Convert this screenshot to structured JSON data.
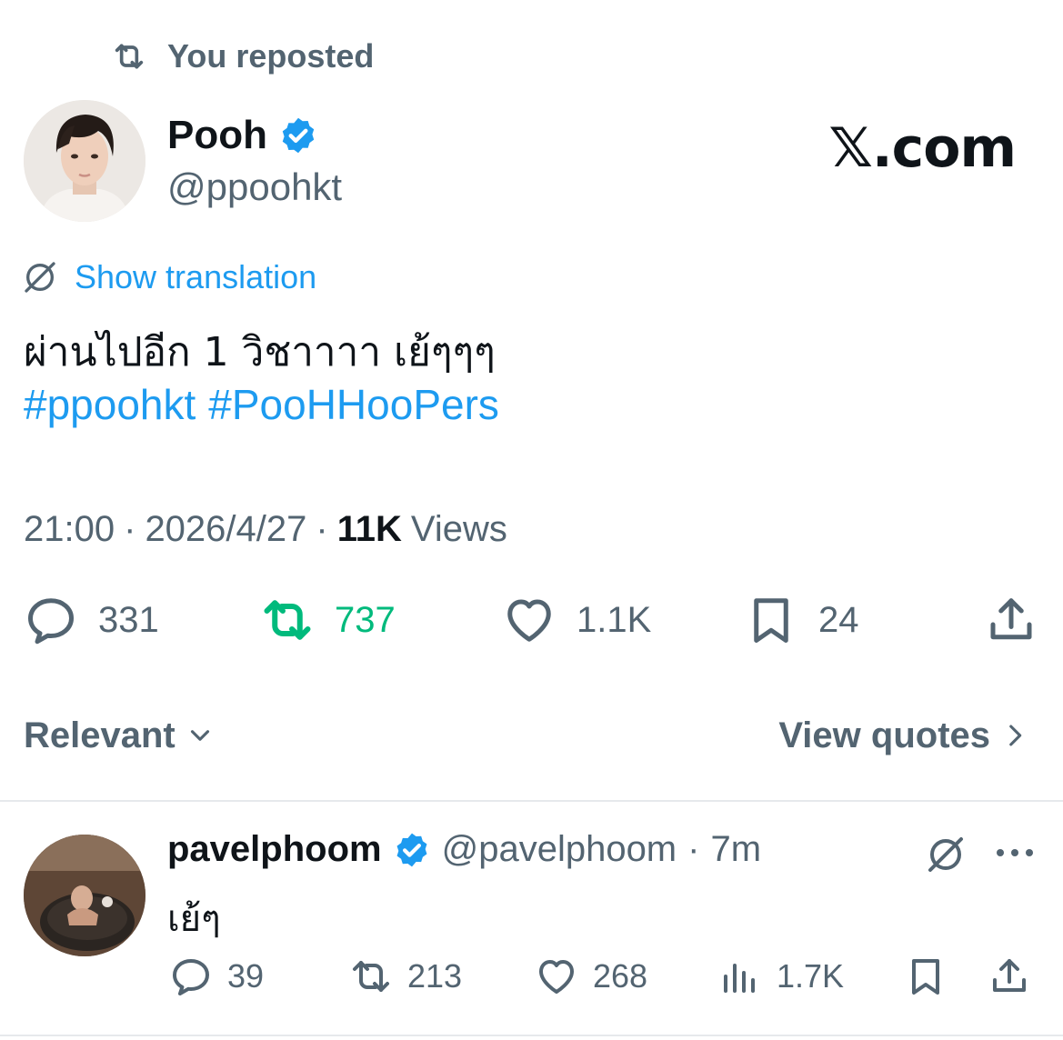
{
  "repost_banner": {
    "label": "You reposted"
  },
  "post": {
    "author_name": "Pooh",
    "author_handle": "@ppoohkt",
    "brand": "𝕏.com",
    "translate_label": "Show translation",
    "text": "ผ่านไปอีก 1 วิชาาาา เย้ๆๆๆ",
    "hashtags": [
      "#ppoohkt",
      "#PooHHooPers"
    ],
    "time": "21:00",
    "date": "2026/4/27",
    "views_count": "11K",
    "views_label": "Views",
    "separator": "·",
    "stats": {
      "replies": "331",
      "reposts": "737",
      "likes": "1.1K",
      "bookmarks": "24"
    }
  },
  "sort": {
    "relevant_label": "Relevant",
    "view_quotes_label": "View quotes"
  },
  "reply": {
    "author_name": "pavelphoom",
    "author_handle": "@pavelphoom",
    "time_ago": "7m",
    "separator": "·",
    "text": "เย้ๆ",
    "stats": {
      "replies": "39",
      "reposts": "213",
      "likes": "268",
      "views": "1.7K"
    }
  },
  "colors": {
    "accent": "#1d9bf0",
    "retweet_active": "#00ba7c",
    "secondary_text": "#536471",
    "primary_text": "#0f1419"
  }
}
